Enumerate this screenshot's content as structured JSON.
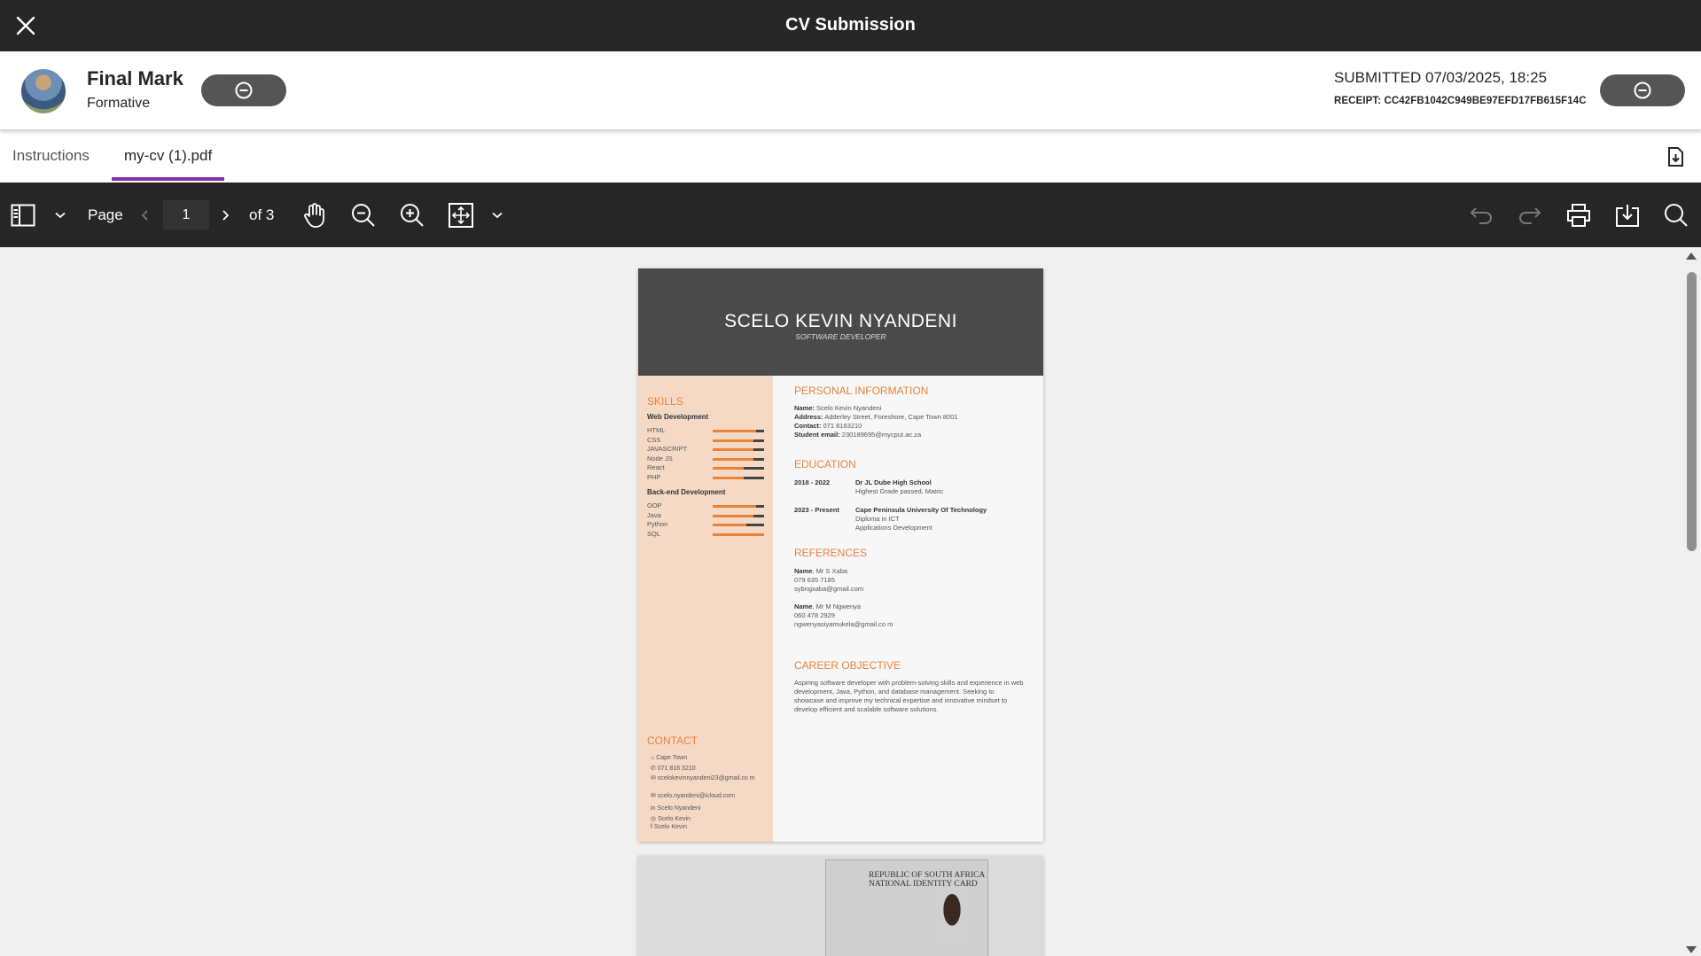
{
  "window": {
    "title": "CV Submission"
  },
  "header": {
    "grade_label": "Final Mark",
    "grade_sub": "Formative",
    "submitted": "SUBMITTED 07/03/2025, 18:25",
    "receipt": "RECEIPT: CC42FB1042C949BE97EFD17FB615F14C"
  },
  "tabs": [
    {
      "label": "Instructions",
      "active": false
    },
    {
      "label": "my-cv (1).pdf",
      "active": true
    }
  ],
  "toolbar": {
    "page_label": "Page",
    "page_value": "1",
    "of_label": "of 3"
  },
  "colors": {
    "topbar": "#262626",
    "accent": "#8a2da5",
    "cv_orange": "#e8833a"
  },
  "cv": {
    "name": "SCELO KEVIN  NYANDENI",
    "role": "SOFTWARE DEVELOPER",
    "skills_heading": "SKILLS",
    "web_heading": "Web Development",
    "web_skills": [
      {
        "name": "HTML",
        "level": 0.85
      },
      {
        "name": "CSS",
        "level": 0.8
      },
      {
        "name": "JAVASCRIPT",
        "level": 0.8
      },
      {
        "name": "Node JS",
        "level": 0.8
      },
      {
        "name": "React",
        "level": 0.6
      },
      {
        "name": "PHP",
        "level": 0.6
      }
    ],
    "backend_heading": "Back-end Development",
    "backend_skills": [
      {
        "name": "OOP",
        "level": 0.85
      },
      {
        "name": "Java",
        "level": 0.8
      },
      {
        "name": "Python",
        "level": 0.65
      },
      {
        "name": "SQL",
        "level": 1.0
      }
    ],
    "contact_heading": "CONTACT",
    "contact": [
      "Cape Town",
      "071 816 3210",
      "scelokevinnyandeni23@gmail.co m",
      "scelo.nyandeni@icloud.com",
      "Scelo Nyandeni",
      "Scelo Kevin",
      "Scelo Kevin"
    ],
    "personal_heading": "PERSONAL INFORMATION",
    "personal": {
      "name_label": "Name:",
      "name_value": "Scelo Kevin Nyandeni",
      "address_label": "Address:",
      "address_value": "Adderley Street, Foreshore, Cape Town 8001",
      "contact_label": "Contact:",
      "contact_value": "071 8163210",
      "email_label": "Student email:",
      "email_value": "230189695@mycput.ac.za"
    },
    "education_heading": "EDUCATION",
    "education": [
      {
        "years": "2018 - 2022",
        "school": "Dr JL Dube High School",
        "line1": "Highest Grade passed, Matric",
        "line2": ""
      },
      {
        "years": "2023 - Present",
        "school": "Cape Peninsula University Of Technology",
        "line1": "Diploma in ICT",
        "line2": "Applications Development"
      }
    ],
    "references_heading": "REFERENCES",
    "references": [
      {
        "label": "Name",
        "name": ", Mr S Xaba",
        "phone": "079 635 7185",
        "email": "sybngxaba@gmail.com"
      },
      {
        "label": "Name",
        "name": ", Mr M Ngwenya",
        "phone": "060 478 2929",
        "email": "ngwenyasiyamukela@gmail.co m"
      }
    ],
    "objective_heading": "CAREER OBJECTIVE",
    "objective": "Aspiring software developer with problem-solving skills and experience in web development, Java, Python, and database management. Seeking to showcase and improve my technical expertise and innovative mindset to develop efficient and scalable software solutions."
  },
  "id_card": {
    "title_line1": "REPUBLIC OF SOUTH AFRICA",
    "title_line2": "NATIONAL IDENTITY CARD"
  }
}
